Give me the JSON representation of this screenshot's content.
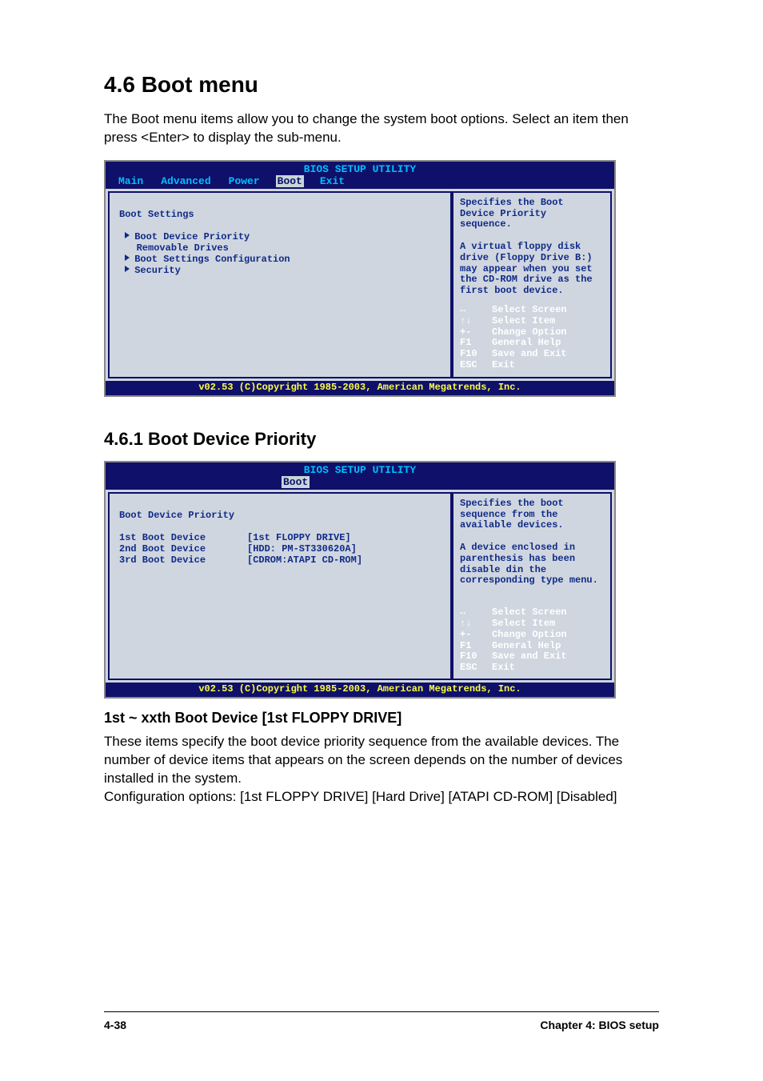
{
  "heading": "4.6     Boot menu",
  "intro": "The Boot menu items allow you to change the system boot options. Select an item then press <Enter> to display the sub-menu.",
  "panel1": {
    "title": "BIOS SETUP UTILITY",
    "tabs": [
      "Main",
      "Advanced",
      "Power",
      "Boot",
      "Exit"
    ],
    "activeTab": "Boot",
    "sectionTitle": "Boot Settings",
    "items": [
      "Boot Device Priority",
      "Removable Drives",
      "Boot Settings Configuration",
      "Security"
    ],
    "help": "Specifies the Boot Device Priority sequence.\n\nA virtual floppy disk drive (Floppy Drive B:) may appear when you set the CD-ROM drive as the first boot device.",
    "footer": "v02.53 (C)Copyright 1985-2003, American Megatrends, Inc."
  },
  "keys": [
    {
      "k": "↔",
      "d": "Select Screen"
    },
    {
      "k": "↑↓",
      "d": "Select Item"
    },
    {
      "k": "+-",
      "d": "Change Option"
    },
    {
      "k": "F1",
      "d": "General Help"
    },
    {
      "k": "F10",
      "d": "Save and Exit"
    },
    {
      "k": "ESC",
      "d": "Exit"
    }
  ],
  "subheading": "4.6.1    Boot Device Priority",
  "panel2": {
    "title": "BIOS SETUP UTILITY",
    "activeTab": "Boot",
    "sectionTitle": "Boot Device Priority",
    "rows": [
      {
        "label": "1st Boot Device",
        "value": "[1st FLOPPY DRIVE]"
      },
      {
        "label": "2nd Boot Device",
        "value": "[HDD: PM-ST330620A]"
      },
      {
        "label": "3rd Boot Device",
        "value": "[CDROM:ATAPI CD-ROM]"
      }
    ],
    "help": "Specifies the boot sequence from the available devices.\n\nA device enclosed in parenthesis has been disable din the corresponding type menu.",
    "footer": "v02.53 (C)Copyright 1985-2003, American Megatrends, Inc."
  },
  "subSection": {
    "title": "1st ~ xxth Boot Device [1st FLOPPY DRIVE]",
    "body": "These items specify the boot device priority sequence from the available devices. The number of device items that appears on the screen depends on the number of devices installed in the system.\nConfiguration options: [1st FLOPPY DRIVE] [Hard Drive] [ATAPI CD-ROM] [Disabled]"
  },
  "pageFooter": {
    "left": "4-38",
    "right": "Chapter 4: BIOS setup"
  }
}
